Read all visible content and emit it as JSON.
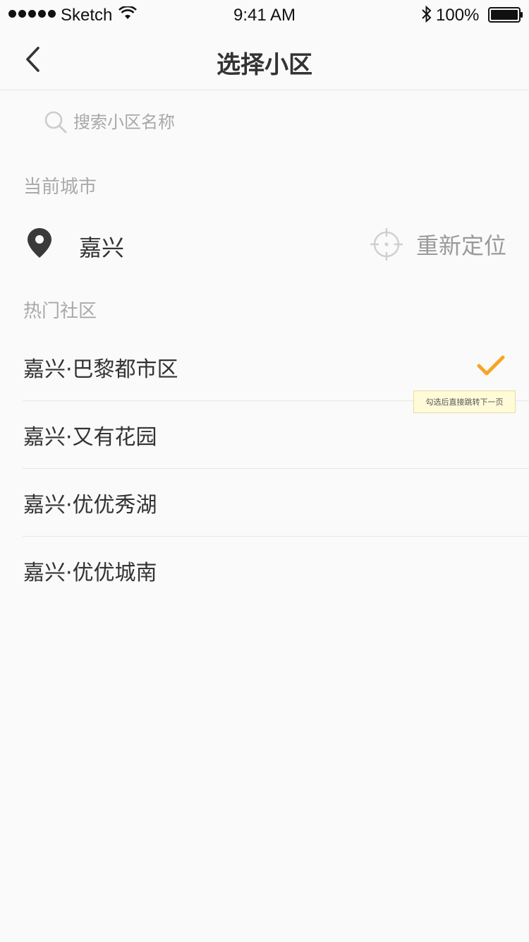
{
  "status_bar": {
    "carrier": "Sketch",
    "time": "9:41 AM",
    "battery": "100%"
  },
  "nav": {
    "title": "选择小区",
    "back_icon": "chevron-left-icon"
  },
  "search": {
    "placeholder": "搜索小区名称",
    "value": "",
    "icon": "search-icon"
  },
  "current_city": {
    "header": "当前城市",
    "name": "嘉兴",
    "relocate_label": "重新定位",
    "icons": [
      "location-pin-icon",
      "crosshair-icon"
    ]
  },
  "hot_communities": {
    "header": "热门社区",
    "items": [
      {
        "label": "嘉兴·巴黎都市区",
        "selected": true
      },
      {
        "label": "嘉兴·又有花园",
        "selected": false
      },
      {
        "label": "嘉兴·优优秀湖",
        "selected": false
      },
      {
        "label": "嘉兴·优优城南",
        "selected": false
      }
    ]
  },
  "tooltip": {
    "text": "勾选后直接跳转下一页"
  },
  "colors": {
    "accent": "#f5a623",
    "background": "#fafafa",
    "muted_text": "#a9a9a9",
    "primary_text": "#333333",
    "tooltip_bg": "#fffbd8"
  }
}
